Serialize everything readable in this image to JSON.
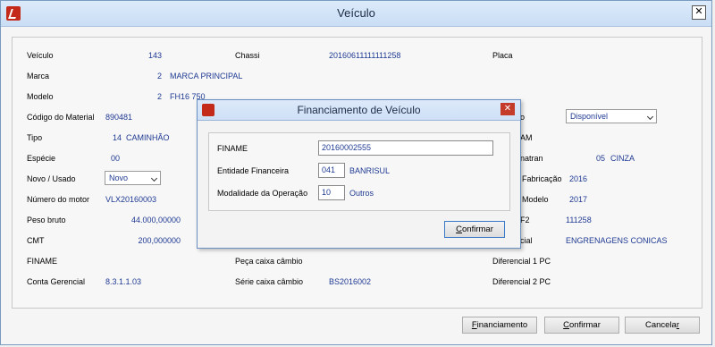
{
  "window": {
    "title": "Veículo",
    "close": "✕"
  },
  "fields": {
    "veiculo": {
      "label": "Veículo",
      "value": "143"
    },
    "chassi": {
      "label": "Chassi",
      "value": "20160611111111258"
    },
    "placa": {
      "label": "Placa"
    },
    "marca": {
      "label": "Marca",
      "code": "2",
      "value": "MARCA PRINCIPAL"
    },
    "modelo": {
      "label": "Modelo",
      "code": "2",
      "value": "FH16 750"
    },
    "codigo_material": {
      "label": "Código do Material",
      "value": "890481"
    },
    "situacao": {
      "label_partial": "o",
      "value": "Disponível"
    },
    "tipo": {
      "label": "Tipo",
      "code": "14",
      "value": "CAMINHÃO"
    },
    "renavam": {
      "label_partial": "AM"
    },
    "especie": {
      "label": "Espécie",
      "value": "00"
    },
    "cor_denatran": {
      "label_partial": "natran",
      "code": "05",
      "value": "CINZA"
    },
    "novo_usado": {
      "label": "Novo / Usado",
      "value": "Novo"
    },
    "ano_fabricacao": {
      "label_partial": "Fabricação",
      "value": "2016"
    },
    "numero_motor": {
      "label": "Número do motor",
      "value": "VLX20160003"
    },
    "ano_modelo": {
      "label_partial": "Modelo",
      "value": "2017"
    },
    "peso_bruto": {
      "label": "Peso bruto",
      "value": "44.000,00000"
    },
    "campo_f2": {
      "label_partial": "F2",
      "value": "111258"
    },
    "cmt": {
      "label": "CMT",
      "value": "200,000000"
    },
    "diferencial": {
      "label_partial": "cial",
      "value": "ENGRENAGENS CONICAS"
    },
    "finame": {
      "label": "FINAME"
    },
    "peca_caixa_cambio": {
      "label": "Peça caixa câmbio"
    },
    "diferencial_1pc": {
      "label": "Diferencial 1 PC"
    },
    "conta_gerencial": {
      "label": "Conta Gerencial",
      "value": "8.3.1.1.03"
    },
    "serie_caixa_cambio": {
      "label": "Série caixa câmbio",
      "value": "BS2016002"
    },
    "diferencial_2pc": {
      "label": "Diferencial 2 PC"
    }
  },
  "buttons": {
    "financiamento": {
      "first": "F",
      "rest": "inanciamento"
    },
    "confirmar": {
      "first": "C",
      "rest": "onfirmar"
    },
    "cancelar": {
      "first": "Cancela",
      "rest": "r"
    }
  },
  "modal": {
    "title": "Financiamento de Veículo",
    "close": "✕",
    "finame": {
      "label": "FINAME",
      "value": "20160002555"
    },
    "entidade": {
      "label": "Entidade Financeira",
      "code": "041",
      "name": "BANRISUL"
    },
    "modalidade": {
      "label": "Modalidade da Operação",
      "code": "10",
      "name": "Outros"
    },
    "confirmar": {
      "first": "C",
      "rest": "onfirmar"
    }
  }
}
